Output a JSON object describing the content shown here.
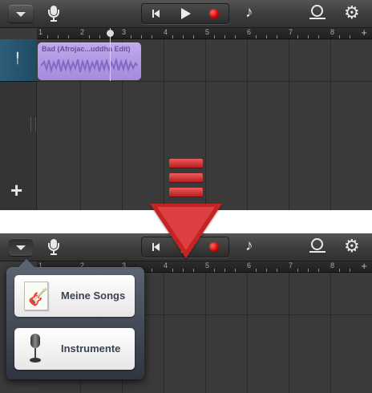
{
  "colors": {
    "region": "#b39ae4",
    "record": "#d40000",
    "track_header": "#2d5e79",
    "arrow": "#c62424"
  },
  "icons": {
    "dropdown": "chevron-down-icon",
    "microphone": "microphone-icon",
    "go_to_beginning": "skip-back-icon",
    "play": "play-icon",
    "record": "record-icon",
    "note": "music-note-icon",
    "loop": "loop-icon",
    "settings": "gear-icon",
    "add_track": "plus-icon"
  },
  "ruler": {
    "bars": [
      "1",
      "2",
      "3",
      "4",
      "5",
      "6",
      "7",
      "8"
    ],
    "plus": "+"
  },
  "region": {
    "label": "Bad (Afrojac...uddha Edit)"
  },
  "add_track": {
    "label": "+"
  },
  "popover": {
    "items": [
      {
        "label": "Meine Songs",
        "icon": "guitar-song-icon"
      },
      {
        "label": "Instrumente",
        "icon": "microphone-icon"
      }
    ]
  }
}
